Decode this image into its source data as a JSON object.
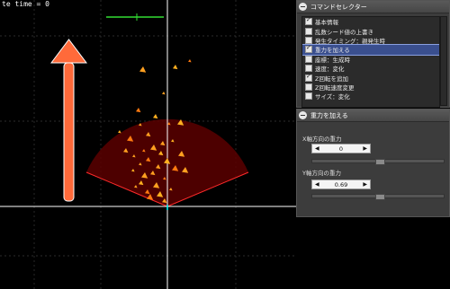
{
  "viewport": {
    "time_label": "te time = 0",
    "colors": {
      "grid": "#3a3a3a",
      "axis": "#ffffff",
      "emitter_fill": "#5a0000",
      "emitter_edge": "#ff2a2a",
      "arrow": "#ff6a3a",
      "particle": "#ffa020"
    }
  },
  "command_panel": {
    "title": "コマンドセレクター",
    "items": [
      {
        "label": "基本情報",
        "checked": true,
        "selected": false
      },
      {
        "label": "乱数シード値の上書き",
        "checked": false,
        "selected": false
      },
      {
        "label": "発生タイミング：親発生時",
        "checked": false,
        "selected": false
      },
      {
        "label": "重力を加える",
        "checked": true,
        "selected": true
      },
      {
        "label": "座標：生成時",
        "checked": false,
        "selected": false
      },
      {
        "label": "速度：変化",
        "checked": false,
        "selected": false
      },
      {
        "label": "Z回転を追加",
        "checked": true,
        "selected": false
      },
      {
        "label": "Z回転速度変更",
        "checked": false,
        "selected": false
      },
      {
        "label": "サイズ：変化",
        "checked": false,
        "selected": false
      }
    ]
  },
  "gravity_panel": {
    "title": "重力を加える",
    "x_label": "X軸方向の重力",
    "x_value": "0",
    "x_slider": 0.5,
    "y_label": "Y軸方向の重力",
    "y_value": "0.69",
    "y_slider": 0.5,
    "arrow_left": "◀",
    "arrow_right": "▶"
  }
}
